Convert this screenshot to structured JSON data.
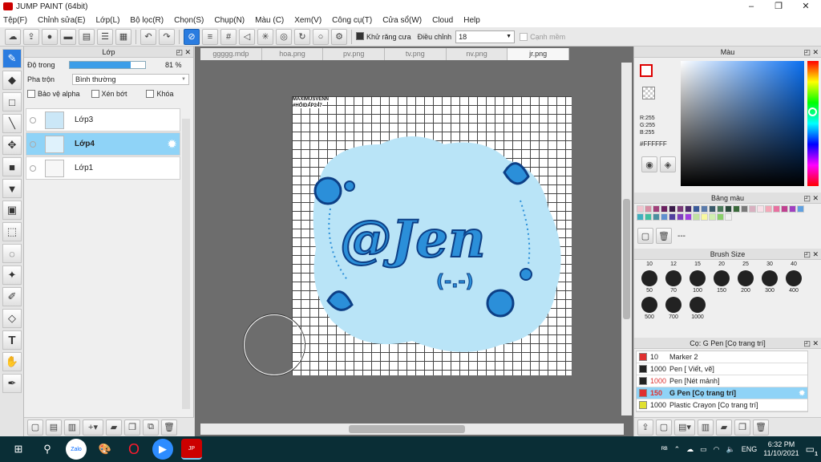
{
  "window": {
    "title": "JUMP PAINT (64bit)",
    "minimize": "–",
    "maximize": "❐",
    "close": "✕"
  },
  "menu": [
    "Tệp(F)",
    "Chỉnh sửa(E)",
    "Lớp(L)",
    "Bộ lọc(R)",
    "Chọn(S)",
    "Chụp(N)",
    "Màu (C)",
    "Xem(V)",
    "Công cụ(T)",
    "Cửa sổ(W)",
    "Cloud",
    "Help"
  ],
  "toolbar": {
    "antialias_label": "Khử răng cưa",
    "adjust_label": "Điều chỉnh",
    "adjust_value": "18",
    "snap_label": "Cạnh mềm"
  },
  "layer_panel": {
    "title": "Lớp",
    "opacity_label": "Độ trong",
    "opacity_value": "81 %",
    "opacity_fraction": 0.81,
    "blend_label": "Pha trộn",
    "blend_value": "Bình thường",
    "protect_alpha": "Bảo vệ alpha",
    "clip": "Xén bớt",
    "lock": "Khóa",
    "layers": [
      {
        "name": "Lớp3",
        "selected": false
      },
      {
        "name": "Lớp4",
        "selected": true
      },
      {
        "name": "Lớp1",
        "selected": false
      }
    ]
  },
  "tabs": [
    {
      "label": "ggggg.mdp",
      "active": false
    },
    {
      "label": "hoa.png",
      "active": false
    },
    {
      "label": "pv.png",
      "active": false
    },
    {
      "label": "tv.png",
      "active": false
    },
    {
      "label": "nv.png",
      "active": false
    },
    {
      "label": "jr.png",
      "active": true
    }
  ],
  "canvas": {
    "watermark_line1": "MAXIMUSVENN",
    "watermark_line2": "#HOIDAP247",
    "art_text": "@Jen",
    "face_text": "(-.-)"
  },
  "color_panel": {
    "title": "Màu",
    "r": "R:255",
    "g": "G:255",
    "b": "B:255",
    "hex": "#FFFFFF"
  },
  "palette_panel": {
    "title": "Bảng màu",
    "colors": [
      "#f2c6d0",
      "#d88fa4",
      "#a0407a",
      "#6a2060",
      "#3a1a4a",
      "#7a3a7a",
      "#4a2a6a",
      "#3a5a9a",
      "#5a7aaa",
      "#3a5a6a",
      "#4a7a5a",
      "#2a4a3a",
      "#3a6a3a",
      "#7a7a7a",
      "#d8b0c0",
      "#f8e0e8",
      "#f4a8b8",
      "#e870a0",
      "#c04090",
      "#a040c0",
      "#60a0e0",
      "#40b0c0",
      "#40c0a0",
      "#4a90a0",
      "#6090d0",
      "#5040a0",
      "#8040c0",
      "#a040e0",
      "#c0e0a0",
      "#f8f8a0",
      "#d0f0b0",
      "#8ad06a",
      "#f0f0f0"
    ]
  },
  "brush_size_panel": {
    "title": "Brush Size",
    "top_row": [
      "10",
      "12",
      "15",
      "20",
      "25",
      "30",
      "40"
    ],
    "rows": [
      [
        "50",
        "70",
        "100",
        "150",
        "200",
        "300",
        "400"
      ],
      [
        "500",
        "700",
        "1000"
      ]
    ]
  },
  "brush_panel": {
    "title": "Cọ: G Pen [Cọ trang trí]",
    "items": [
      {
        "size": "10",
        "name": "Marker 2",
        "color": "#e03030",
        "selected": false
      },
      {
        "size": "1000",
        "name": "Pen [ Viết, vẽ]",
        "color": "#222222",
        "selected": false
      },
      {
        "size": "1000",
        "name": "Pen [Nét mảnh]",
        "color": "#222222",
        "selected": false
      },
      {
        "size": "150",
        "name": "G Pen [Cọ trang trí]",
        "color": "#e03030",
        "selected": true
      },
      {
        "size": "1000",
        "name": "Plastic Crayon [Cọ trang trí]",
        "color": "#e0e030",
        "selected": false
      }
    ]
  },
  "taskbar": {
    "lang": "ENG",
    "time": "6:32 PM",
    "date": "11/10/2021",
    "badge": "1"
  }
}
